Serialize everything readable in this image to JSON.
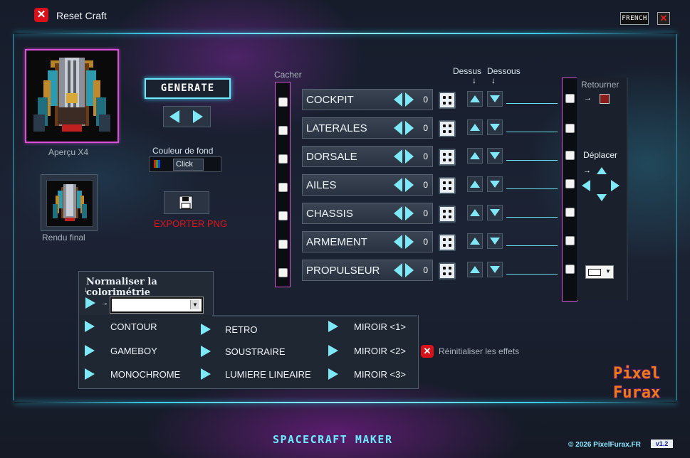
{
  "window": {
    "title": "Reset Craft",
    "language": "FRENCH",
    "close_icon": "close-icon"
  },
  "preview": {
    "label": "Aperçu X4",
    "final_label": "Rendu final"
  },
  "generate": {
    "label": "GENERATE"
  },
  "background": {
    "label": "Couleur de fond",
    "value": "Click"
  },
  "export": {
    "label": "EXPORTER PNG"
  },
  "columns": {
    "hide": "Cacher",
    "above": "Dessus",
    "below": "Dessous",
    "down_arrow": "↓"
  },
  "parts": [
    {
      "name": "COCKPIT",
      "value": "0"
    },
    {
      "name": "LATERALES",
      "value": "0"
    },
    {
      "name": "DORSALE",
      "value": "0"
    },
    {
      "name": "AILES",
      "value": "0"
    },
    {
      "name": "CHASSIS",
      "value": "0"
    },
    {
      "name": "ARMEMENT",
      "value": "0"
    },
    {
      "name": "PROPULSEUR",
      "value": "0"
    }
  ],
  "right_panel": {
    "return_label": "Retourner",
    "move_label": "Déplacer",
    "arrow": "→",
    "return_color": "#8b1c1c"
  },
  "normalize": {
    "label": "Normaliser la colorimétrie",
    "down_arrow": "↓",
    "arrow": "→"
  },
  "effects": {
    "col1": [
      "CONTOUR",
      "GAMEBOY",
      "MONOCHROME"
    ],
    "col2": [
      "RETRO",
      "SOUSTRAIRE",
      "LUMIERE LINEAIRE"
    ],
    "col3": [
      "MIROIR <1>",
      "MIROIR <2>",
      "MIROIR <3>"
    ],
    "reset_label": "Réinitialiser les effets"
  },
  "footer": {
    "app_title": "SPACECRAFT MAKER",
    "copyright": "© 2026 PixelFurax.FR",
    "version": "v1.2",
    "logo_line1": "Pixel",
    "logo_line2": "Furax"
  },
  "colors": {
    "accent": "#6fe9ff",
    "danger": "#e0161c",
    "frame": "#d84fd8"
  }
}
